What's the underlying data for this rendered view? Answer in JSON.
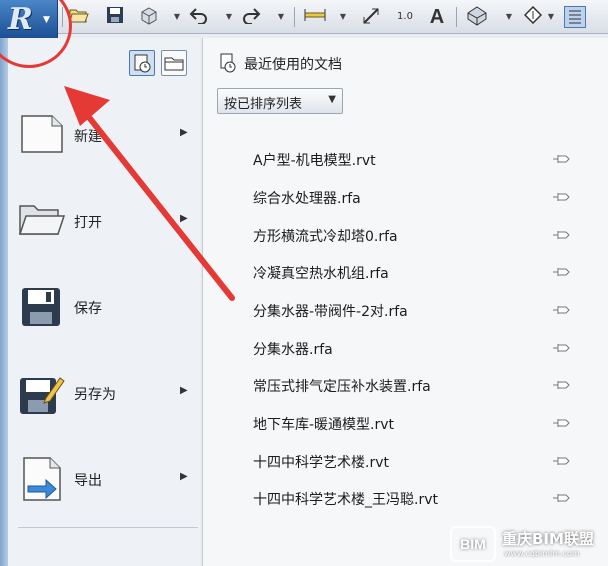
{
  "app": {
    "button_glyph": "R",
    "accent": "#2b6cb8",
    "highlight_color": "#e53935"
  },
  "toolbar": {
    "icons": [
      "open-icon",
      "save-icon",
      "sync-icon",
      "undo-icon",
      "redo-icon",
      "measure-icon",
      "dimension-icon",
      "tag-icon",
      "text-icon",
      "3d-view-icon",
      "section-icon",
      "thin-lines-icon"
    ],
    "text_tool_label": "A",
    "tag_label": "1.0"
  },
  "menu": {
    "items": [
      {
        "label": "新建",
        "icon": "new-document-icon",
        "has_submenu": true
      },
      {
        "label": "打开",
        "icon": "open-folder-icon",
        "has_submenu": true
      },
      {
        "label": "保存",
        "icon": "floppy-disk-icon",
        "has_submenu": false
      },
      {
        "label": "另存为",
        "icon": "save-as-icon",
        "has_submenu": true
      },
      {
        "label": "导出",
        "icon": "export-icon",
        "has_submenu": true
      }
    ]
  },
  "recent": {
    "title": "最近使用的文档",
    "sort_label": "按已排序列表",
    "documents": [
      "A户型-机电模型.rvt",
      "综合水处理器.rfa",
      "方形横流式冷却塔0.rfa",
      "冷凝真空热水机组.rfa",
      "分集水器-带阀件-2对.rfa",
      "分集水器.rfa",
      "常压式排气定压补水装置.rfa",
      "地下车库-暖通模型.rvt",
      "十四中科学艺术楼.rvt",
      "十四中科学艺术楼_王冯聪.rvt"
    ]
  },
  "watermark": {
    "logo": "BIM",
    "text": "重庆BIM联盟",
    "sub": "www.cqbimlm.com"
  }
}
